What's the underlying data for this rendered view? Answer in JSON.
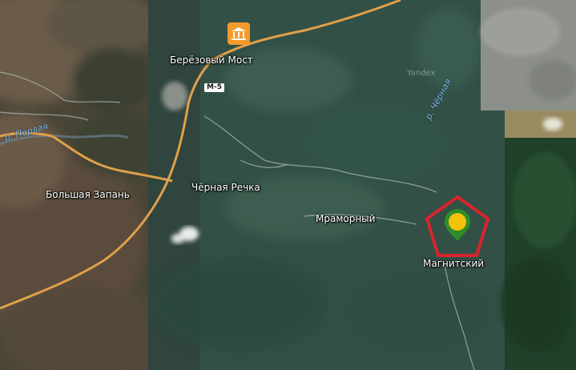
{
  "map": {
    "settlements": {
      "berezovy_most": "Берёзовый Мост",
      "chernaya_rechka": "Чёрная Речка",
      "bolshaya_zapan": "Большая Запань",
      "mramorny": "Мраморный",
      "magnitsky": "Магнитский"
    },
    "rivers": {
      "pervaya": "р. Первая",
      "chernaya": "р. Чёрная"
    },
    "road_shield": "М-5",
    "watermark": "Yandex",
    "poi_icon": "landmark-icon",
    "marker_icon": "pentagon-marker-icon",
    "colors": {
      "road": "#e1a04a",
      "poi_background": "#f39a2c",
      "marker_outline": "#d8242e",
      "marker_fill": "#2f8d2a",
      "marker_center": "#f4c20d",
      "river_label": "#7fb9e6"
    }
  }
}
